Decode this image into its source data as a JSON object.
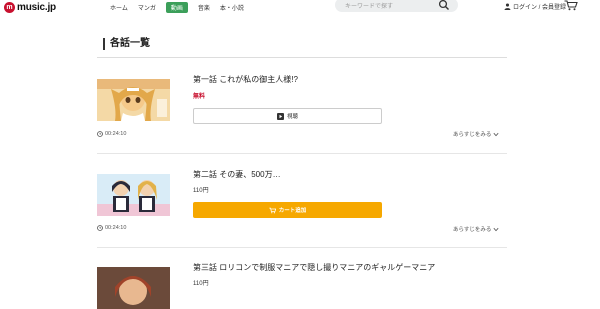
{
  "header": {
    "logo_mark": "m",
    "logo_text": "music.jp",
    "nav": [
      "ホーム",
      "マンガ",
      "動画",
      "音楽",
      "本・小説"
    ],
    "active_nav": "動画",
    "search_placeholder": "キーワードで探す",
    "login_label": "ログイン / 会員登録"
  },
  "section": {
    "title": "各話一覧"
  },
  "episodes": [
    {
      "title": "第一話 これが私の御主人様!?",
      "price": "無料",
      "action_label": "視聴",
      "duration": "00:24:10",
      "synopsis_label": "あらすじをみる"
    },
    {
      "title": "第二話 その妻、500万…",
      "price": "110円",
      "action_label": "カート追加",
      "duration": "00:24:10",
      "synopsis_label": "あらすじをみる"
    },
    {
      "title": "第三話 ロリコンで制服マニアで隠し撮りマニアのギャルゲーマニア",
      "price": "110円"
    }
  ],
  "colors": {
    "brand": "#c8102e",
    "active_nav": "#3c9f5a",
    "cart_button": "#f6a800",
    "free_price": "#c8102e"
  }
}
